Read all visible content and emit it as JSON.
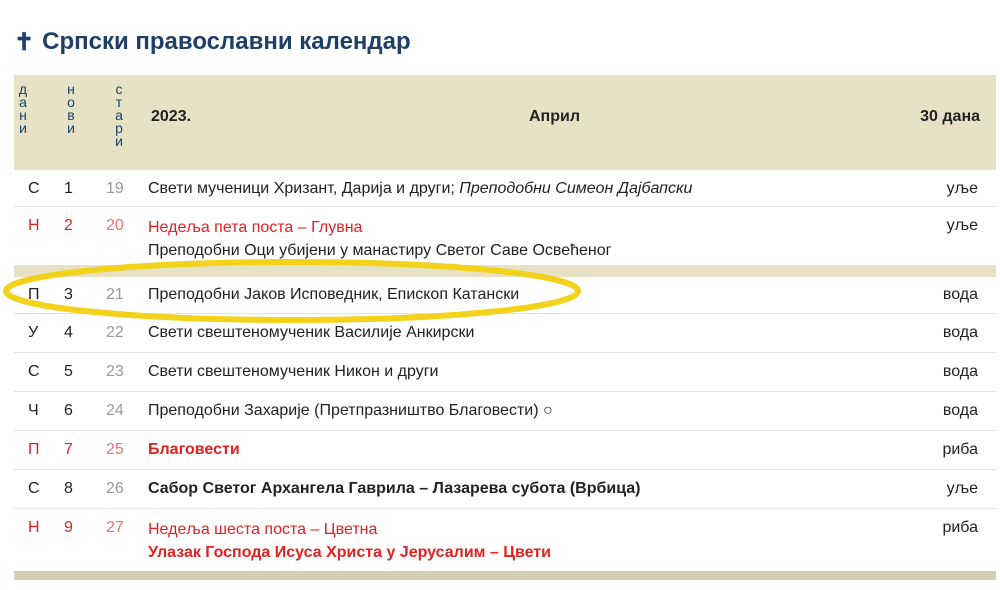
{
  "page": {
    "icon": "✝",
    "title": "Српски православни календар"
  },
  "header": {
    "col_day": [
      "д",
      "а",
      "н",
      "и"
    ],
    "col_new": [
      "н",
      "о",
      "в",
      "и"
    ],
    "col_old": [
      "с",
      "т",
      "а",
      "р",
      "и"
    ],
    "year": "2023.",
    "month": "Април",
    "days_count": "30 дана"
  },
  "rows": [
    {
      "day": "С",
      "new": "1",
      "old": "19",
      "desc_plain": "Свети мученици Хризант, Дарија и други; ",
      "desc_italic": "Преподобни Симеон Дајбапски",
      "fast": "уље",
      "red": false
    },
    {
      "day": "Н",
      "new": "2",
      "old": "20",
      "line1": "Недеља пета поста – Глувна",
      "line2": "Преподобни Оци убијени у манастиру Светог Саве Освећеног",
      "fast": "уље",
      "red": true
    },
    {
      "day": "П",
      "new": "3",
      "old": "21",
      "desc": "Преподобни Јаков Исповедник, Епископ Катански",
      "fast": "вода",
      "red": false
    },
    {
      "day": "У",
      "new": "4",
      "old": "22",
      "desc": "Свети свештеномученик Василије Анкирски",
      "fast": "вода",
      "red": false
    },
    {
      "day": "С",
      "new": "5",
      "old": "23",
      "desc": "Свети свештеномученик Никон и други",
      "fast": "вода",
      "red": false
    },
    {
      "day": "Ч",
      "new": "6",
      "old": "24",
      "desc": "Преподобни Захарије (Претпразништво Благовести) ○",
      "fast": "вода",
      "red": false
    },
    {
      "day": "П",
      "new": "7",
      "old": "25",
      "desc": "Благовести",
      "fast": "риба",
      "red": true
    },
    {
      "day": "С",
      "new": "8",
      "old": "26",
      "desc": "Сабор Светог Архангела Гаврила – Лазарева субота (Врбица)",
      "fast": "уље",
      "red": false
    },
    {
      "day": "Н",
      "new": "9",
      "old": "27",
      "line1": "Недеља шеста поста – Цветна",
      "line2": "Улазак Господа Исуса Христа у Јерусалим – Цвети",
      "fast": "риба",
      "red": true
    }
  ],
  "colors": {
    "header_bg": "#e6e2c6",
    "title": "#1f3f66",
    "red": "#e42020",
    "highlight": "#f2d21b"
  }
}
